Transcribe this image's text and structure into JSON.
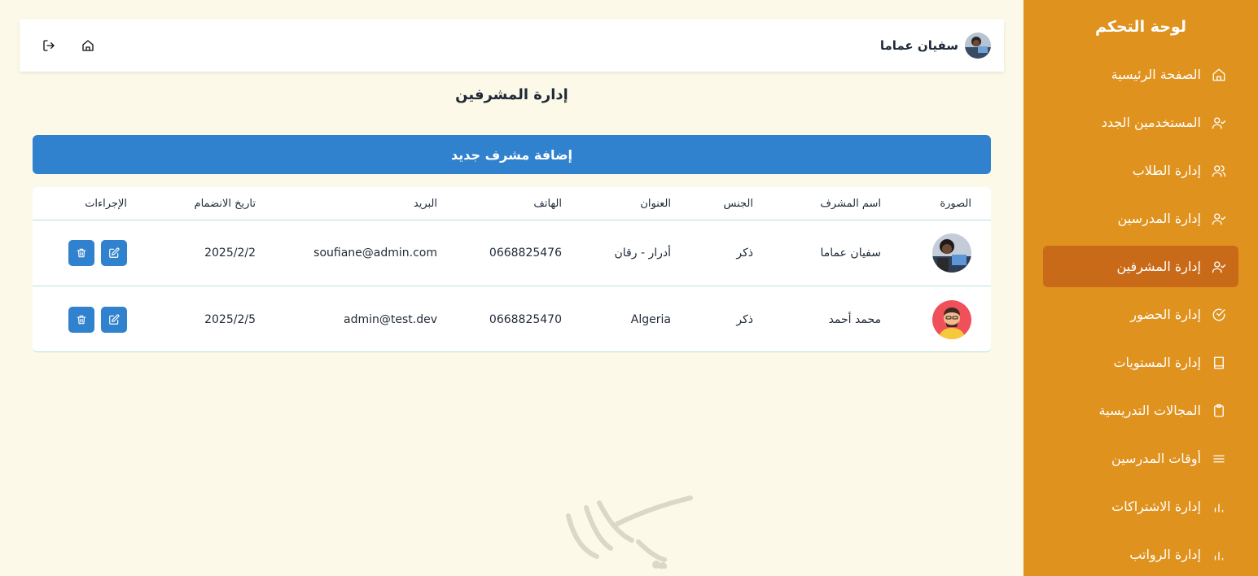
{
  "sidebar": {
    "title": "لوحة التحكم",
    "items": [
      {
        "label": "الصفحة الرئيسية",
        "icon": "home-icon",
        "active": false
      },
      {
        "label": "المستخدمين الجدد",
        "icon": "user-check-icon",
        "active": false
      },
      {
        "label": "إدارة الطلاب",
        "icon": "users-icon",
        "active": false
      },
      {
        "label": "إدارة المدرسين",
        "icon": "user-check-icon",
        "active": false
      },
      {
        "label": "إدارة المشرفين",
        "icon": "user-check-icon",
        "active": true
      },
      {
        "label": "إدارة الحضور",
        "icon": "check-circle-icon",
        "active": false
      },
      {
        "label": "إدارة المستويات",
        "icon": "book-icon",
        "active": false
      },
      {
        "label": "المجالات التدريسية",
        "icon": "clipboard-icon",
        "active": false
      },
      {
        "label": "أوقات المدرسين",
        "icon": "menu-icon",
        "active": false
      },
      {
        "label": "إدارة الاشتراكات",
        "icon": "bar-chart-icon",
        "active": false
      },
      {
        "label": "إدارة الرواتب",
        "icon": "bar-chart-icon",
        "active": false
      }
    ],
    "colors": {
      "background": "#df921e",
      "active": "#c86a18"
    }
  },
  "header": {
    "user_name": "سفيان عماما",
    "home_icon": "home-icon",
    "logout_icon": "logout-icon"
  },
  "main": {
    "title": "إدارة المشرفين",
    "add_button": "إضافة مشرف جديد",
    "accent": "#3182ce"
  },
  "table": {
    "columns": [
      "الصورة",
      "اسم المشرف",
      "الجنس",
      "العنوان",
      "الهاتف",
      "البريد",
      "تاريخ الانضمام",
      "الإجراءات"
    ],
    "rows": [
      {
        "name": "سفيان عماما",
        "gender": "ذكر",
        "address": "أدرار - رقان",
        "phone": "0668825476",
        "email": "soufiane@admin.com",
        "joined": "2025/2/2"
      },
      {
        "name": "محمد أحمد",
        "gender": "ذكر",
        "address": "Algeria",
        "phone": "0668825470",
        "email": "admin@test.dev",
        "joined": "2025/2/5"
      }
    ]
  }
}
